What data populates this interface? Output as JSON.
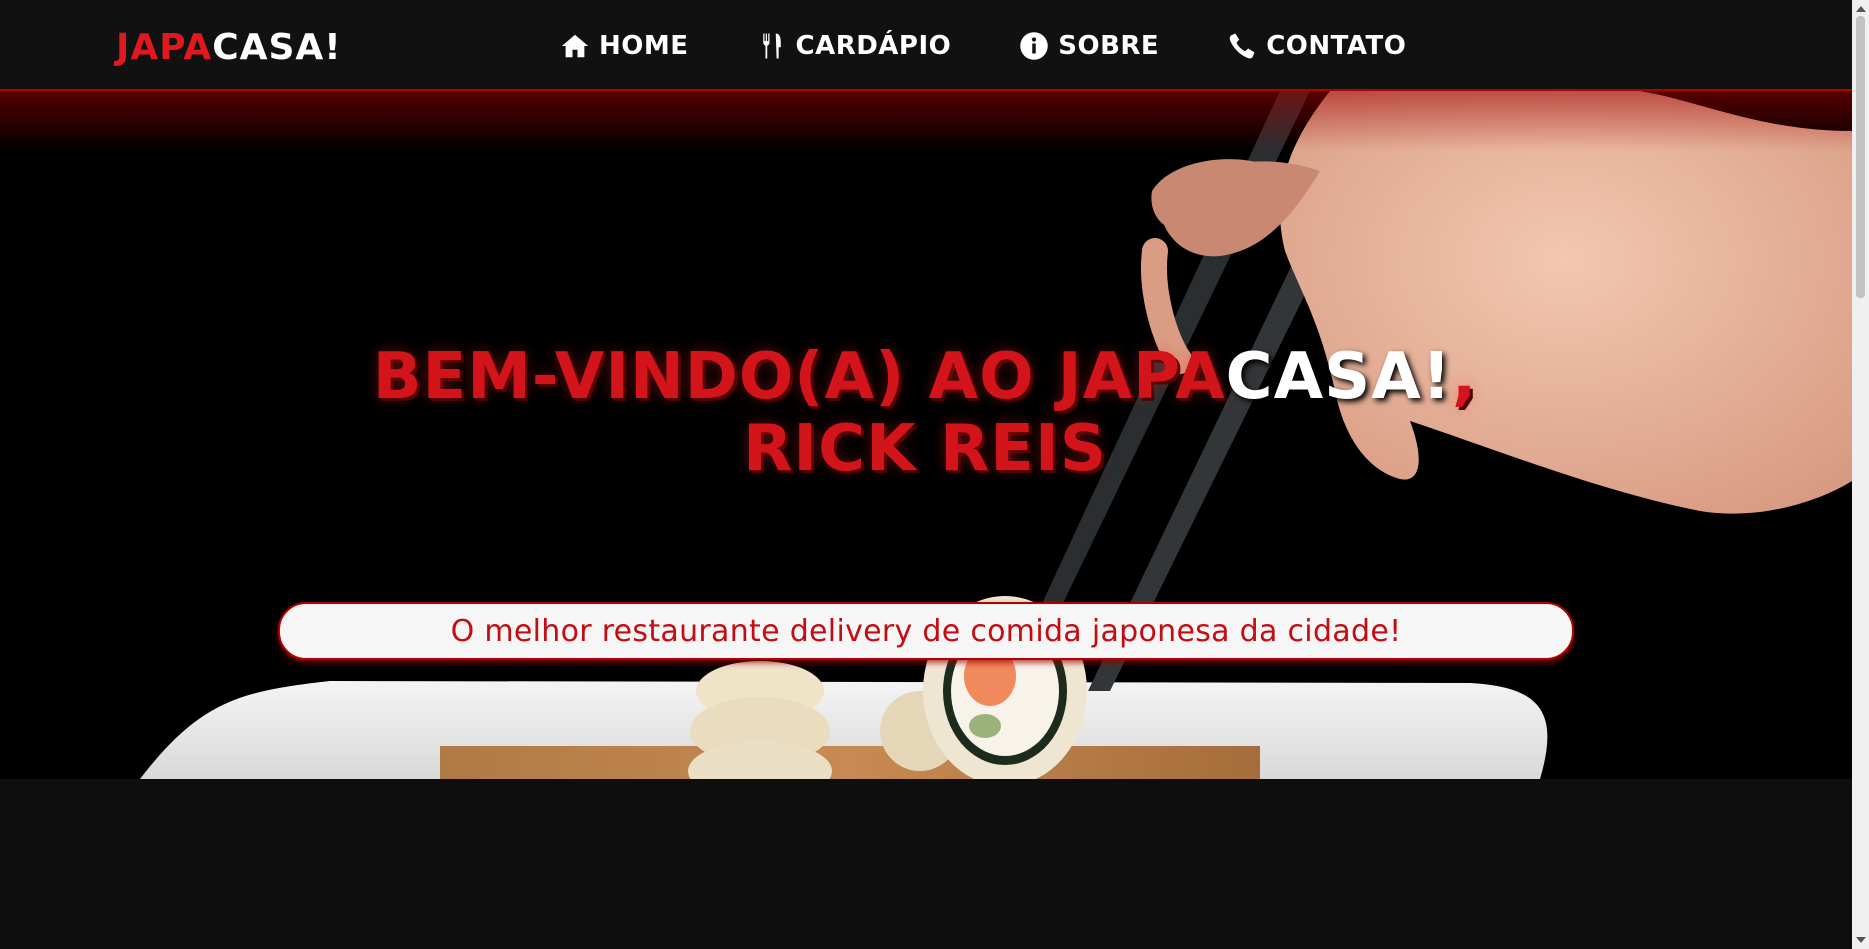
{
  "brand": {
    "part1": "JAPA",
    "part2": "CASA!"
  },
  "nav": {
    "items": [
      {
        "label": "HOME",
        "icon": "home-icon"
      },
      {
        "label": "CARDÁPIO",
        "icon": "fork-knife-icon"
      },
      {
        "label": "SOBRE",
        "icon": "info-icon"
      },
      {
        "label": "CONTATO",
        "icon": "phone-icon"
      }
    ]
  },
  "hero": {
    "headline_red": "BEM-VINDO(A) AO JAPA",
    "headline_white": "CASA!",
    "headline_comma": ",",
    "user_name": "RICK REIS",
    "tagline": "O melhor restaurante delivery de comida japonesa da cidade!",
    "background_image": "hand-with-chopsticks-holding-sushi"
  },
  "colors": {
    "accent": "#d4141b",
    "background": "#0e0e0e",
    "navbar": "#111111"
  }
}
